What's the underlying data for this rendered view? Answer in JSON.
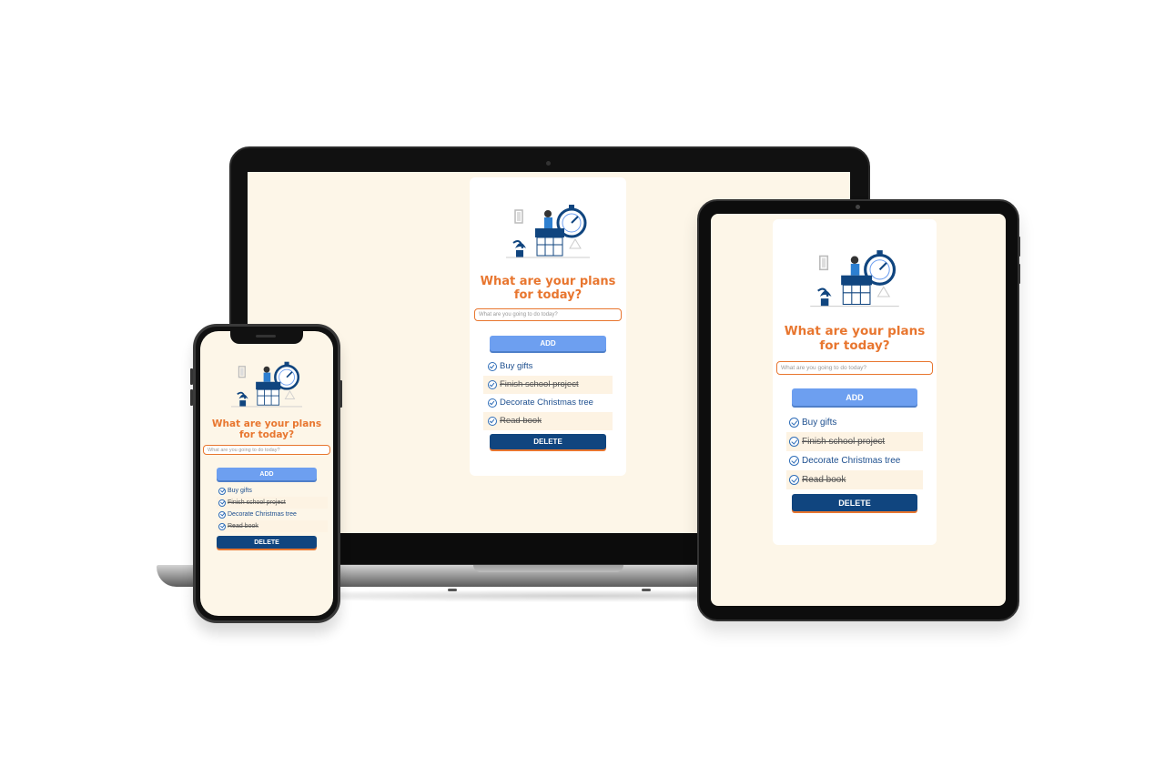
{
  "app": {
    "title": "What are your plans for today?",
    "input_placeholder": "What are you going to do today?",
    "add_label": "ADD",
    "delete_label": "DELETE",
    "todos": [
      {
        "text": "Buy gifts",
        "done": false
      },
      {
        "text": "Finish school project",
        "done": true
      },
      {
        "text": "Decorate Christmas tree",
        "done": false
      },
      {
        "text": "Read book",
        "done": true
      }
    ]
  },
  "colors": {
    "title": "#e8762f",
    "add_button": "#6d9ff0",
    "delete_button": "#10457f",
    "background": "#fdf6e8",
    "item_text": "#1d4f8f"
  },
  "icons": [
    "check-circle-icon",
    "illustration-person-stopwatch"
  ]
}
